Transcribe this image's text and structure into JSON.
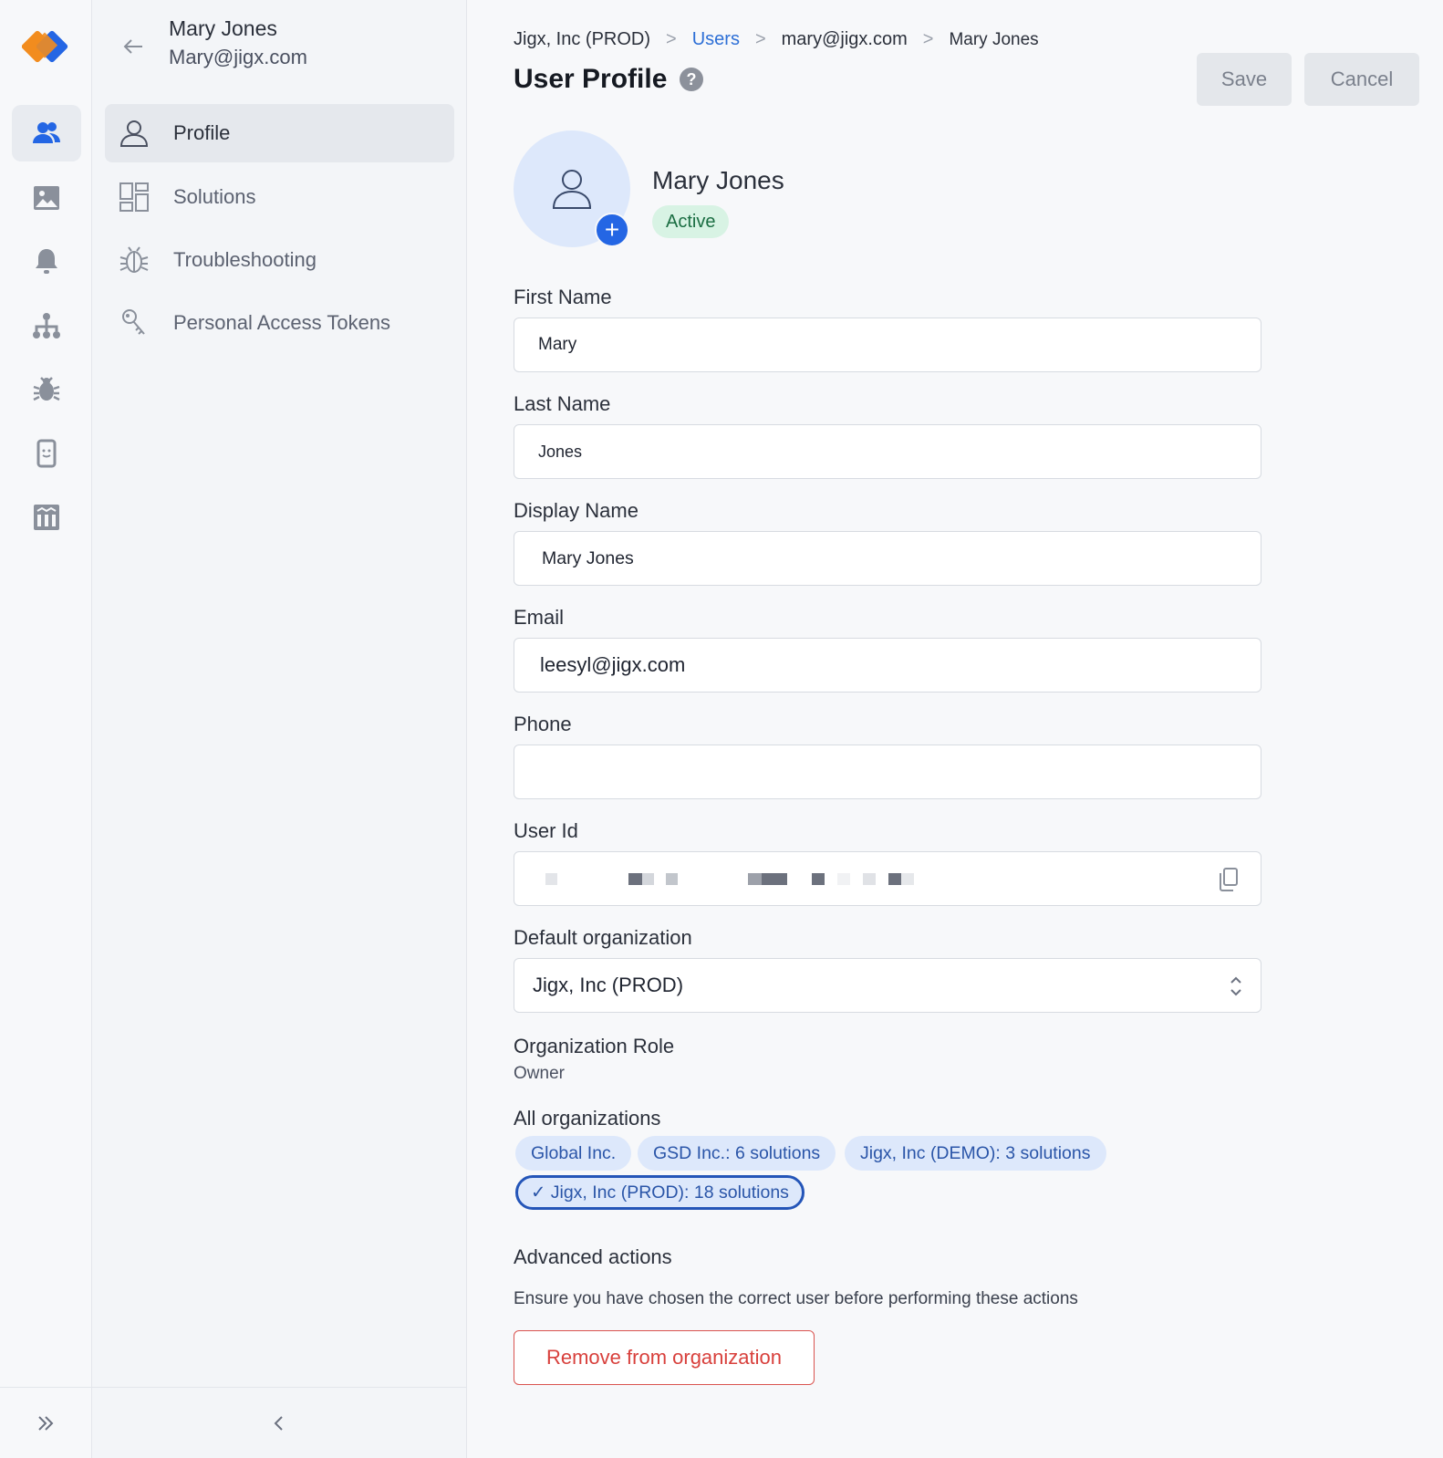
{
  "app": {
    "brand_colors": {
      "primary": "#2466e4",
      "logo_orange": "#f28c1e",
      "logo_blue": "#2466e4"
    }
  },
  "rail": {
    "items": [
      {
        "name": "users-icon",
        "active": true
      },
      {
        "name": "image-icon",
        "active": false
      },
      {
        "name": "bell-icon",
        "active": false
      },
      {
        "name": "hierarchy-icon",
        "active": false
      },
      {
        "name": "bug-icon",
        "active": false
      },
      {
        "name": "device-icon",
        "active": false
      },
      {
        "name": "warehouse-icon",
        "active": false
      }
    ],
    "expand_icon": "double-chevron-right-icon"
  },
  "nav": {
    "user_name": "Mary Jones",
    "user_email": "Mary@jigx.com",
    "items": [
      {
        "label": "Profile",
        "icon": "person-icon",
        "active": true
      },
      {
        "label": "Solutions",
        "icon": "grid-icon",
        "active": false
      },
      {
        "label": "Troubleshooting",
        "icon": "bug-outline-icon",
        "active": false
      },
      {
        "label": "Personal Access Tokens",
        "icon": "keys-icon",
        "active": false
      }
    ],
    "collapse_icon": "chevron-left-icon"
  },
  "breadcrumb": {
    "org": "Jigx, Inc (PROD)",
    "users": "Users",
    "email": "mary@jigx.com",
    "current": "Mary Jones",
    "separator": ">"
  },
  "header": {
    "title": "User Profile",
    "help": "?",
    "save_label": "Save",
    "cancel_label": "Cancel"
  },
  "profile": {
    "name": "Mary Jones",
    "status": "Active",
    "add_photo": "+"
  },
  "form": {
    "first_name": {
      "label": "First Name",
      "value": "Mary"
    },
    "last_name": {
      "label": "Last Name",
      "value": "Jones"
    },
    "display_name": {
      "label": "Display Name",
      "value": "Mary Jones"
    },
    "email": {
      "label": "Email",
      "value": "leesyl@jigx.com"
    },
    "phone": {
      "label": "Phone",
      "value": ""
    },
    "user_id": {
      "label": "User Id",
      "copy_icon": "copy-icon"
    },
    "default_org": {
      "label": "Default organization",
      "value": "Jigx, Inc (PROD)"
    },
    "org_role": {
      "label": "Organization Role",
      "value": "Owner"
    }
  },
  "organizations": {
    "label": "All organizations",
    "chips": [
      {
        "label": "Global Inc.",
        "selected": false
      },
      {
        "label": "GSD Inc.: 6 solutions",
        "selected": false
      },
      {
        "label": "Jigx, Inc (DEMO): 3 solutions",
        "selected": false
      },
      {
        "label": "✓ Jigx, Inc (PROD): 18 solutions",
        "selected": true
      }
    ]
  },
  "advanced": {
    "title": "Advanced actions",
    "note": "Ensure you have chosen the correct user before performing these actions",
    "remove_label": "Remove from organization"
  }
}
